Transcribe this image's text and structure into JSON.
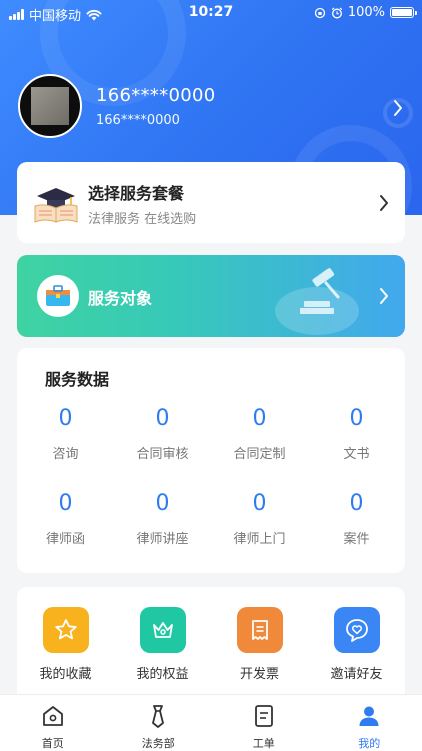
{
  "status_bar": {
    "carrier": "中国移动",
    "time": "10:27",
    "battery": "100%",
    "battery_level": 1.0
  },
  "profile": {
    "phone_main": "166****0000",
    "phone_sub": "166****0000"
  },
  "package": {
    "title": "选择服务套餐",
    "subtitle": "法律服务 在线选购"
  },
  "service_target": {
    "label": "服务对象"
  },
  "service_data": {
    "title": "服务数据",
    "stats": [
      {
        "value": "0",
        "label": "咨询"
      },
      {
        "value": "0",
        "label": "合同审核"
      },
      {
        "value": "0",
        "label": "合同定制"
      },
      {
        "value": "0",
        "label": "文书"
      },
      {
        "value": "0",
        "label": "律师函"
      },
      {
        "value": "0",
        "label": "律师讲座"
      },
      {
        "value": "0",
        "label": "律师上门"
      },
      {
        "value": "0",
        "label": "案件"
      }
    ]
  },
  "tools": [
    {
      "label": "我的收藏",
      "icon": "star-icon",
      "color": "#f7b21d"
    },
    {
      "label": "我的权益",
      "icon": "crown-icon",
      "color": "#1fc7a2"
    },
    {
      "label": "开发票",
      "icon": "invoice-icon",
      "color": "#f08a3a"
    },
    {
      "label": "邀请好友",
      "icon": "heart-chat-icon",
      "color": "#3a86f5"
    }
  ],
  "tabbar": {
    "items": [
      {
        "label": "首页",
        "icon": "home-icon"
      },
      {
        "label": "法务部",
        "icon": "tie-icon"
      },
      {
        "label": "工单",
        "icon": "document-icon"
      },
      {
        "label": "我的",
        "icon": "user-icon"
      }
    ],
    "active_index": 3,
    "active_color": "#2f7cf0"
  }
}
